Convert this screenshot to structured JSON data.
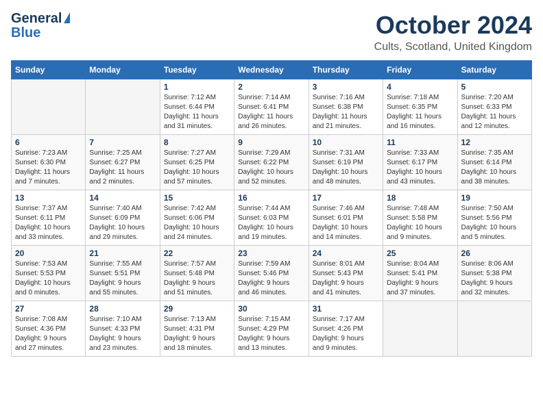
{
  "header": {
    "logo_line1": "General",
    "logo_line2": "Blue",
    "month": "October 2024",
    "location": "Cults, Scotland, United Kingdom"
  },
  "days_of_week": [
    "Sunday",
    "Monday",
    "Tuesday",
    "Wednesday",
    "Thursday",
    "Friday",
    "Saturday"
  ],
  "weeks": [
    [
      {
        "day": "",
        "info": ""
      },
      {
        "day": "",
        "info": ""
      },
      {
        "day": "1",
        "info": "Sunrise: 7:12 AM\nSunset: 6:44 PM\nDaylight: 11 hours\nand 31 minutes."
      },
      {
        "day": "2",
        "info": "Sunrise: 7:14 AM\nSunset: 6:41 PM\nDaylight: 11 hours\nand 26 minutes."
      },
      {
        "day": "3",
        "info": "Sunrise: 7:16 AM\nSunset: 6:38 PM\nDaylight: 11 hours\nand 21 minutes."
      },
      {
        "day": "4",
        "info": "Sunrise: 7:18 AM\nSunset: 6:35 PM\nDaylight: 11 hours\nand 16 minutes."
      },
      {
        "day": "5",
        "info": "Sunrise: 7:20 AM\nSunset: 6:33 PM\nDaylight: 11 hours\nand 12 minutes."
      }
    ],
    [
      {
        "day": "6",
        "info": "Sunrise: 7:23 AM\nSunset: 6:30 PM\nDaylight: 11 hours\nand 7 minutes."
      },
      {
        "day": "7",
        "info": "Sunrise: 7:25 AM\nSunset: 6:27 PM\nDaylight: 11 hours\nand 2 minutes."
      },
      {
        "day": "8",
        "info": "Sunrise: 7:27 AM\nSunset: 6:25 PM\nDaylight: 10 hours\nand 57 minutes."
      },
      {
        "day": "9",
        "info": "Sunrise: 7:29 AM\nSunset: 6:22 PM\nDaylight: 10 hours\nand 52 minutes."
      },
      {
        "day": "10",
        "info": "Sunrise: 7:31 AM\nSunset: 6:19 PM\nDaylight: 10 hours\nand 48 minutes."
      },
      {
        "day": "11",
        "info": "Sunrise: 7:33 AM\nSunset: 6:17 PM\nDaylight: 10 hours\nand 43 minutes."
      },
      {
        "day": "12",
        "info": "Sunrise: 7:35 AM\nSunset: 6:14 PM\nDaylight: 10 hours\nand 38 minutes."
      }
    ],
    [
      {
        "day": "13",
        "info": "Sunrise: 7:37 AM\nSunset: 6:11 PM\nDaylight: 10 hours\nand 33 minutes."
      },
      {
        "day": "14",
        "info": "Sunrise: 7:40 AM\nSunset: 6:09 PM\nDaylight: 10 hours\nand 29 minutes."
      },
      {
        "day": "15",
        "info": "Sunrise: 7:42 AM\nSunset: 6:06 PM\nDaylight: 10 hours\nand 24 minutes."
      },
      {
        "day": "16",
        "info": "Sunrise: 7:44 AM\nSunset: 6:03 PM\nDaylight: 10 hours\nand 19 minutes."
      },
      {
        "day": "17",
        "info": "Sunrise: 7:46 AM\nSunset: 6:01 PM\nDaylight: 10 hours\nand 14 minutes."
      },
      {
        "day": "18",
        "info": "Sunrise: 7:48 AM\nSunset: 5:58 PM\nDaylight: 10 hours\nand 9 minutes."
      },
      {
        "day": "19",
        "info": "Sunrise: 7:50 AM\nSunset: 5:56 PM\nDaylight: 10 hours\nand 5 minutes."
      }
    ],
    [
      {
        "day": "20",
        "info": "Sunrise: 7:53 AM\nSunset: 5:53 PM\nDaylight: 10 hours\nand 0 minutes."
      },
      {
        "day": "21",
        "info": "Sunrise: 7:55 AM\nSunset: 5:51 PM\nDaylight: 9 hours\nand 55 minutes."
      },
      {
        "day": "22",
        "info": "Sunrise: 7:57 AM\nSunset: 5:48 PM\nDaylight: 9 hours\nand 51 minutes."
      },
      {
        "day": "23",
        "info": "Sunrise: 7:59 AM\nSunset: 5:46 PM\nDaylight: 9 hours\nand 46 minutes."
      },
      {
        "day": "24",
        "info": "Sunrise: 8:01 AM\nSunset: 5:43 PM\nDaylight: 9 hours\nand 41 minutes."
      },
      {
        "day": "25",
        "info": "Sunrise: 8:04 AM\nSunset: 5:41 PM\nDaylight: 9 hours\nand 37 minutes."
      },
      {
        "day": "26",
        "info": "Sunrise: 8:06 AM\nSunset: 5:38 PM\nDaylight: 9 hours\nand 32 minutes."
      }
    ],
    [
      {
        "day": "27",
        "info": "Sunrise: 7:08 AM\nSunset: 4:36 PM\nDaylight: 9 hours\nand 27 minutes."
      },
      {
        "day": "28",
        "info": "Sunrise: 7:10 AM\nSunset: 4:33 PM\nDaylight: 9 hours\nand 23 minutes."
      },
      {
        "day": "29",
        "info": "Sunrise: 7:13 AM\nSunset: 4:31 PM\nDaylight: 9 hours\nand 18 minutes."
      },
      {
        "day": "30",
        "info": "Sunrise: 7:15 AM\nSunset: 4:29 PM\nDaylight: 9 hours\nand 13 minutes."
      },
      {
        "day": "31",
        "info": "Sunrise: 7:17 AM\nSunset: 4:26 PM\nDaylight: 9 hours\nand 9 minutes."
      },
      {
        "day": "",
        "info": ""
      },
      {
        "day": "",
        "info": ""
      }
    ]
  ]
}
